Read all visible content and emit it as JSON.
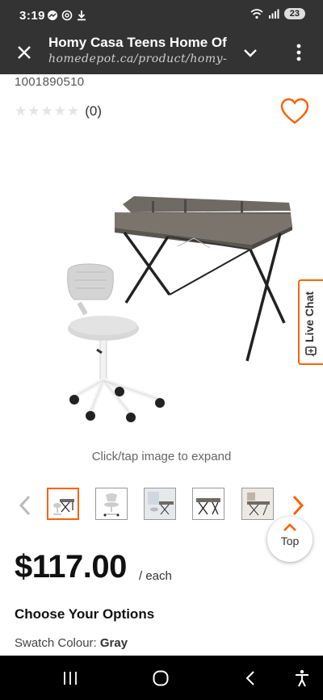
{
  "status_bar": {
    "time": "3:19",
    "notification_icons": [
      "messenger-icon",
      "chatgpt-icon",
      "download-icon"
    ],
    "status_icons": [
      "wifi-icon",
      "signal-icon"
    ],
    "battery": "23"
  },
  "browser": {
    "title": "Homy Casa Teens Home Of",
    "url": "homedepot.ca/product/homy-casa",
    "icons": [
      "close-icon",
      "chevron-down-icon",
      "more-vert-icon"
    ]
  },
  "product": {
    "sku": "1001890510",
    "rating_count": "(0)",
    "image_caption": "Click/tap image to expand",
    "thumbnail_count": 5,
    "active_thumbnail": 0,
    "price": "$117.00",
    "price_unit": "/ each"
  },
  "live_chat": {
    "label": "Live Chat"
  },
  "top_button": {
    "label": "Top"
  },
  "options": {
    "title": "Choose Your Options",
    "swatch_label": "Swatch Colour:",
    "swatch_value": "Gray"
  },
  "nav_bar": {
    "icons": [
      "recent-apps-icon",
      "home-icon",
      "back-icon",
      "accessibility-icon"
    ]
  },
  "colors": {
    "accent": "#f96302",
    "status_bg": "#333333"
  }
}
